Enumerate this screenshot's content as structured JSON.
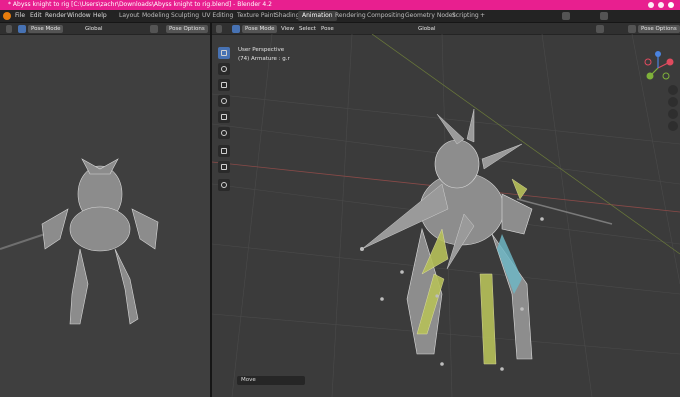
{
  "window": {
    "title": "* Abyss knight to rig [C:\\Users\\zachr\\Downloads\\Abyss knight to rig.blend] - Blender 4.2"
  },
  "menu": [
    "File",
    "Edit",
    "Render",
    "Window",
    "Help"
  ],
  "workspaces": [
    {
      "label": "Layout"
    },
    {
      "label": "Modeling"
    },
    {
      "label": "Sculpting"
    },
    {
      "label": "UV Editing"
    },
    {
      "label": "Texture Paint"
    },
    {
      "label": "Shading"
    },
    {
      "label": "Animation",
      "active": true
    },
    {
      "label": "Rendering"
    },
    {
      "label": "Compositing"
    },
    {
      "label": "Geometry Nodes"
    },
    {
      "label": "Scripting"
    }
  ],
  "add_workspace_label": "+",
  "left_viewport": {
    "mode": "Pose Mode",
    "orientation": "Global",
    "pose_options": "Pose Options"
  },
  "right_viewport": {
    "mode": "Pose Mode",
    "menus": [
      "View",
      "Select",
      "Pose"
    ],
    "orientation": "Global",
    "pose_options": "Pose Options",
    "overlay_line1": "User Perspective",
    "overlay_line2": "(74) Armature : g.r"
  },
  "operator_panel": "Move",
  "gizmo": {
    "x": "X",
    "y": "Y",
    "z": "Z"
  },
  "colors": {
    "titlebar": "#e81f8f",
    "accent_blue": "#4772b3",
    "bone_yellow": "#b7c15a",
    "bone_cyan": "#6fb6c4",
    "axis_x": "#e04a5e",
    "axis_y": "#7fb13a",
    "axis_z": "#4b84e0"
  },
  "icons": [
    "blender-logo-icon",
    "select-box-icon",
    "cursor-icon",
    "move-icon",
    "rotate-icon",
    "scale-icon",
    "transform-icon",
    "annotate-icon",
    "measure-icon",
    "relax-icon",
    "zoom-icon",
    "hand-icon",
    "camera-icon",
    "grid-icon"
  ]
}
